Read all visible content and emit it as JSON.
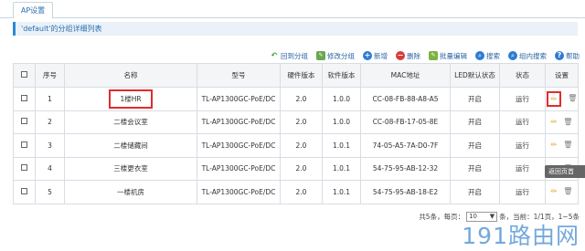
{
  "tabs": [
    {
      "label": "AP设置"
    }
  ],
  "page_title": "'default'的分组详细列表",
  "toolbar": {
    "back_label": "回到分组",
    "edit_group_label": "修改分组",
    "add_label": "新增",
    "delete_label": "删除",
    "batch_edit_label": "批量编辑",
    "search_label": "搜索",
    "group_search_label": "组内搜索",
    "help_label": "帮助"
  },
  "table": {
    "columns": [
      "序号",
      "名称",
      "型号",
      "硬件版本",
      "软件版本",
      "MAC地址",
      "LED默认状态",
      "状态",
      "设置"
    ],
    "rows": [
      {
        "index": "1",
        "name": "1楼HR",
        "model": "TL-AP1300GC-PoE/DC",
        "hw": "2.0",
        "sw": "1.0.0",
        "mac": "CC-08-FB-88-A8-A5",
        "led": "开启",
        "status": "运行"
      },
      {
        "index": "2",
        "name": "二楼会议室",
        "model": "TL-AP1300GC-PoE/DC",
        "hw": "2.0",
        "sw": "1.0.0",
        "mac": "CC-08-FB-17-05-8E",
        "led": "开启",
        "status": "运行"
      },
      {
        "index": "3",
        "name": "二楼储藏间",
        "model": "TL-AP1300GC-PoE/DC",
        "hw": "2.0",
        "sw": "1.0.1",
        "mac": "74-05-A5-7A-D0-7F",
        "led": "开启",
        "status": "运行"
      },
      {
        "index": "4",
        "name": "三楼更衣室",
        "model": "TL-AP1300GC-PoE/DC",
        "hw": "2.0",
        "sw": "1.0.1",
        "mac": "54-75-95-AB-12-32",
        "led": "开启",
        "status": "运行"
      },
      {
        "index": "5",
        "name": "一楼机房",
        "model": "TL-AP1300GC-PoE/DC",
        "hw": "2.0",
        "sw": "1.0.1",
        "mac": "54-75-95-AB-18-E2",
        "led": "开启",
        "status": "运行"
      }
    ]
  },
  "pager": {
    "total_text": "共5条，每页：",
    "page_size": "10",
    "page_size_arrow": "▼",
    "page_info": "条，当前：1/1页，1~5条"
  },
  "back_top_label": "返回页首",
  "watermark_text": "191路由网",
  "icons": {
    "back": "arrow-back-icon",
    "edit_group": "edit-icon",
    "add": "plus-icon",
    "delete": "minus-icon",
    "batch_edit": "batch-edit-icon",
    "search": "search-icon",
    "group_search": "search-icon",
    "help": "help-icon",
    "row_edit": "pencil-icon",
    "row_delete": "trash-icon"
  },
  "colors": {
    "accent": "#2c8ad8",
    "highlight_border": "#e02c2c",
    "link": "#2a63a4",
    "pencil": "#e39a1a"
  }
}
